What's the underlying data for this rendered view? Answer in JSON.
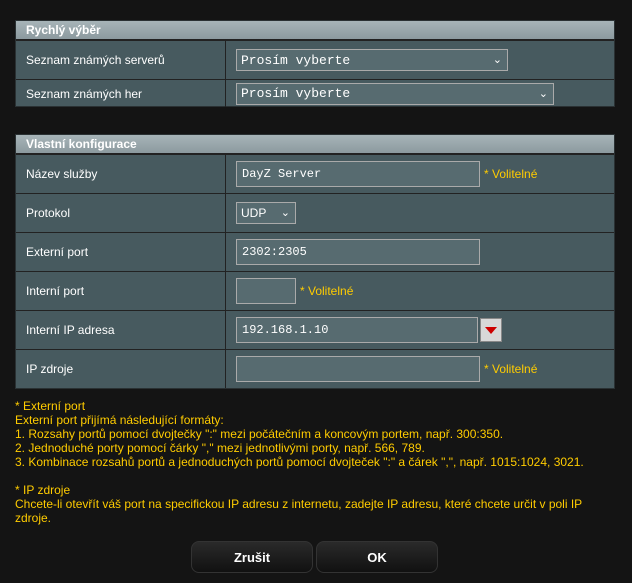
{
  "quick_select": {
    "title": "Rychlý výběr",
    "server_list_label": "Seznam známých serverů",
    "server_list_value": "Prosím vyberte",
    "game_list_label": "Seznam známých her",
    "game_list_value": "Prosím vyberte"
  },
  "custom_config": {
    "title": "Vlastní konfigurace",
    "service_name_label": "Název služby",
    "service_name_value": "DayZ Server",
    "service_name_hint": "* Volitelné",
    "protocol_label": "Protokol",
    "protocol_value": "UDP",
    "external_port_label": "Externí port",
    "external_port_value": "2302:2305",
    "internal_port_label": "Interní port",
    "internal_port_value": "",
    "internal_port_hint": "* Volitelné",
    "internal_ip_label": "Interní IP adresa",
    "internal_ip_value": "192.168.1.10",
    "source_ip_label": "IP zdroje",
    "source_ip_value": "",
    "source_ip_hint": "* Volitelné"
  },
  "notes": {
    "ext_title": "* Externí port",
    "ext_line1": "Externí port přijímá následující formáty:",
    "ext_line2": "1. Rozsahy portů pomocí dvojtečky \":\" mezi počátečním a koncovým portem, např. 300:350.",
    "ext_line3": "2. Jednoduché porty pomocí čárky \",\" mezi jednotlivými porty, např. 566, 789.",
    "ext_line4": "3. Kombinace rozsahů portů a jednoduchých portů pomocí dvojteček \":\" a čárek \",\", např. 1015:1024, 3021.",
    "ip_title": "* IP zdroje",
    "ip_line1": "Chcete-li otevřít váš port na specifickou IP adresu z internetu, zadejte IP adresu, které chcete určit v poli IP zdroje."
  },
  "buttons": {
    "cancel": "Zrušit",
    "ok": "OK"
  },
  "colors": {
    "accent": "#ffcc00",
    "panel": "#475a5f",
    "background": "#141414"
  }
}
